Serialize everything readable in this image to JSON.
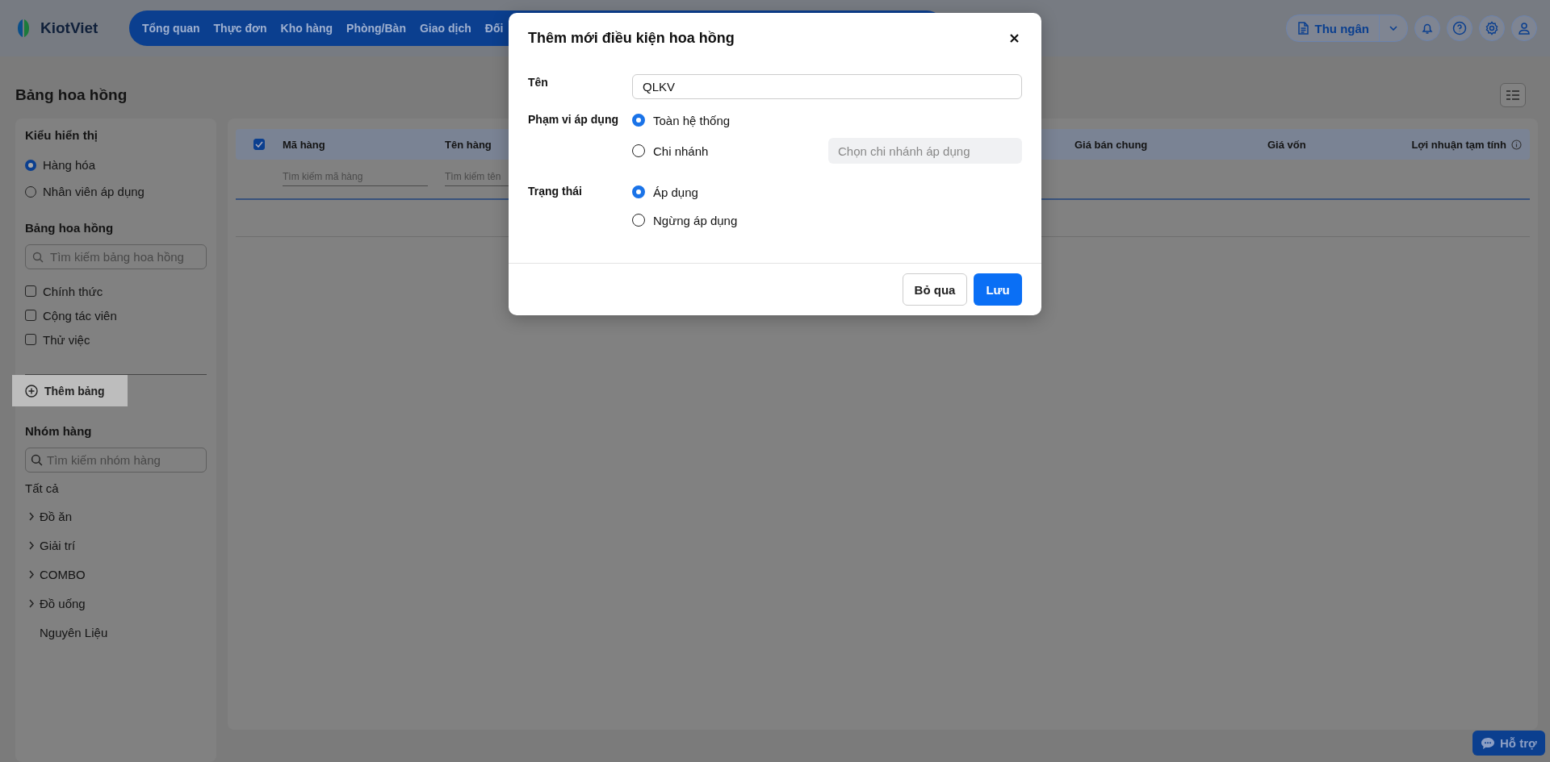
{
  "app": {
    "logo": "KiotViet",
    "nav": [
      "Tổng quan",
      "Thực đơn",
      "Kho hàng",
      "Phòng/Bàn",
      "Giao dịch",
      "Đối"
    ],
    "role_button": "Thu ngân"
  },
  "page": {
    "title": "Bảng hoa hồng"
  },
  "sidebar": {
    "display": {
      "title": "Kiểu hiển thị",
      "options": [
        {
          "label": "Hàng hóa",
          "selected": true
        },
        {
          "label": "Nhân viên áp dụng",
          "selected": false
        }
      ]
    },
    "tables": {
      "title": "Bảng hoa hồng",
      "search_placeholder": "Tìm kiếm bảng hoa hồng",
      "items": [
        {
          "label": "Chính thức",
          "checked": false
        },
        {
          "label": "Cộng tác viên",
          "checked": false
        },
        {
          "label": "Thử việc",
          "checked": false
        }
      ],
      "add_button": "Thêm bảng"
    },
    "groups": {
      "title": "Nhóm hàng",
      "search_placeholder": "Tìm kiếm nhóm hàng",
      "all": "Tất cả",
      "items": [
        {
          "label": "Đồ ăn",
          "expandable": true
        },
        {
          "label": "Giải trí",
          "expandable": true
        },
        {
          "label": "COMBO",
          "expandable": true
        },
        {
          "label": "Đồ uống",
          "expandable": true
        },
        {
          "label": "Nguyên Liệu",
          "expandable": false
        }
      ]
    }
  },
  "table": {
    "header_checked": true,
    "columns": [
      {
        "label": "Mã hàng",
        "filter_placeholder": "Tìm kiếm mã hàng"
      },
      {
        "label": "Tên hàng",
        "filter_placeholder": "Tìm kiếm tên"
      },
      {
        "label": "Giá bán chung"
      },
      {
        "label": "Giá vốn"
      },
      {
        "label": "Lợi nhuận tạm tính",
        "info": true
      }
    ]
  },
  "dialog": {
    "title": "Thêm mới điều kiện hoa hồng",
    "name": {
      "label": "Tên",
      "value": "QLKV"
    },
    "scope": {
      "label": "Phạm vi áp dụng",
      "options": [
        {
          "label": "Toàn hệ thống",
          "selected": true
        },
        {
          "label": "Chi nhánh",
          "selected": false
        }
      ],
      "branch_placeholder": "Chọn chi nhánh áp dụng"
    },
    "status": {
      "label": "Trạng thái",
      "options": [
        {
          "label": "Áp dụng",
          "selected": true
        },
        {
          "label": "Ngừng áp dụng",
          "selected": false
        }
      ]
    },
    "cancel_button": "Bỏ qua",
    "save_button": "Lưu"
  },
  "help_button": "Hỗ trợ"
}
